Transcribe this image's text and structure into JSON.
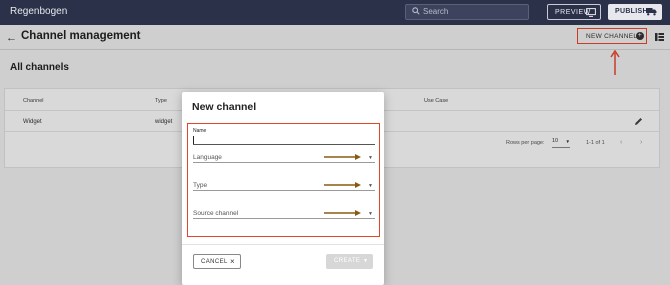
{
  "app": {
    "name": "Regenbogen",
    "search_placeholder": "Search",
    "preview_label": "PREVIEW",
    "publish_label": "PUBLISH"
  },
  "header": {
    "back_glyph": "←",
    "title": "Channel management",
    "new_channel_label": "NEW CHANNEL",
    "new_channel_icon": "+"
  },
  "section": {
    "title": "All channels"
  },
  "table": {
    "columns": [
      "Channel",
      "Type",
      "Use Case"
    ],
    "rows": [
      {
        "channel": "Widget",
        "type": "widget"
      }
    ],
    "rows_per_page_label": "Rows per page:",
    "rows_per_page_value": "10",
    "range_label": "1-1 of 1"
  },
  "dialog": {
    "title": "New channel",
    "name_label": "Name",
    "name_value": "",
    "language_label": "Language",
    "type_label": "Type",
    "source_label": "Source channel",
    "cancel_label": "CANCEL",
    "create_label": "CREATE"
  },
  "colors": {
    "topbar": "#2b3148",
    "highlight": "#e4442a",
    "annotation_arrow": "#8a5a12"
  },
  "icons": [
    "search-icon",
    "preview-icon",
    "truck-icon",
    "back-icon",
    "add-circle-icon",
    "view-toggle-icon",
    "edit-icon",
    "close-icon",
    "dropdown-icon"
  ]
}
